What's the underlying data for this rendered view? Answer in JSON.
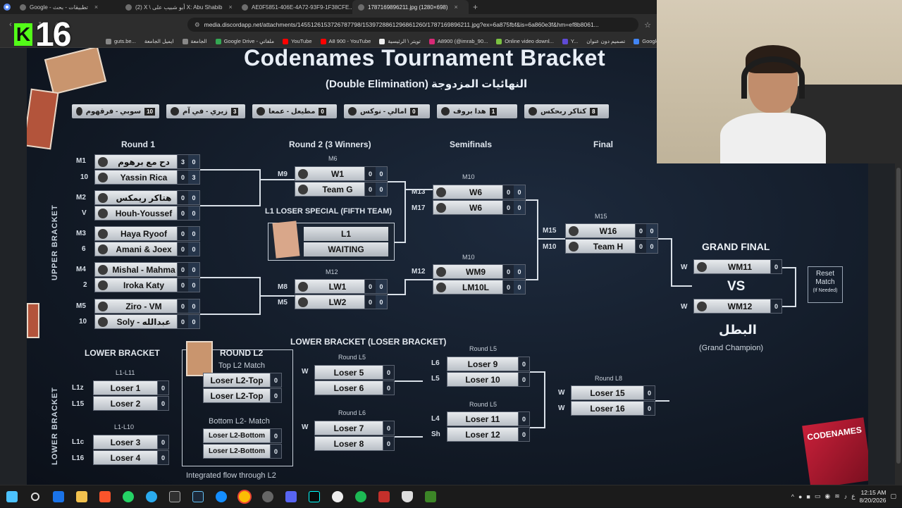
{
  "browser": {
    "tabs": [
      {
        "label": "Google - تطبيقات - بحث",
        "active": false
      },
      {
        "label": "(2) X \\ أبو شبيب على X: Abu Shabib",
        "active": false
      },
      {
        "label": "AE0F5851-406E-4A72-93F9-1F38CFE...",
        "active": false
      },
      {
        "label": "1787169896211.jpg (1280×698)",
        "active": true
      }
    ],
    "new_tab": "+",
    "url": "media.discordapp.net/attachments/1455126153726787798/1539728861296861260/1787169896211.jpg?ex=6a875fbf&is=6a860e3f&hm=ef8b8061...",
    "bookmarks": [
      "guts.be...",
      "ايميل الجامعة",
      "الجامعة",
      "Google Drive - ملفاتي",
      "YouTube",
      "A8 900 - YouTube",
      "تويتر \\ الرئيسية",
      "A8900 (@imrab_90...",
      "Online video downl...",
      "Y...",
      "تصميم دون عنوان",
      "Google"
    ]
  },
  "stream_overlay": {
    "platform_letter": "K",
    "counter": "16"
  },
  "bracket": {
    "title": "Codenames Tournament Bracket",
    "subtitle": "(Double Elimination) النهائيات المزدوجة",
    "team_strip": [
      {
        "name": "سوبي - فرقهوم",
        "n": "10"
      },
      {
        "name": "زيري - في آم",
        "n": "3"
      },
      {
        "name": "مطيعل - عمعا",
        "n": "0"
      },
      {
        "name": "امالي - نوكس",
        "n": "0"
      },
      {
        "name": "هدا بروف",
        "n": "1"
      },
      {
        "name": "كتاكر ربحكس",
        "n": "8"
      }
    ],
    "columns": {
      "round1": "Round 1",
      "round2": "Round 2 (3 Winners)",
      "semis": "Semifinals",
      "final": "Final"
    },
    "upper_label": "UPPER BRACKET",
    "lower_label": "LOWER BRACKET",
    "round1": [
      {
        "match": "M1",
        "a": {
          "seed": "",
          "name": "دح مع برهوم",
          "s1": "3",
          "s2": "0"
        },
        "b": {
          "seed": "10",
          "name": "Yassin Rica",
          "s1": "0",
          "s2": "3"
        }
      },
      {
        "match": "M2",
        "a": {
          "seed": "",
          "name": "هتاكر ريمكس",
          "s1": "0",
          "s2": "0"
        },
        "b": {
          "seed": "V",
          "name": "Houh-Youssef",
          "s1": "0",
          "s2": "0"
        }
      },
      {
        "match": "M3",
        "a": {
          "seed": "",
          "name": "Haya Ryoof",
          "s1": "0",
          "s2": "0"
        },
        "b": {
          "seed": "6",
          "name": "Amani & Joex",
          "s1": "0",
          "s2": "0"
        }
      },
      {
        "match": "M4",
        "a": {
          "seed": "",
          "name": "Mishal - Mahma",
          "s1": "0",
          "s2": "0"
        },
        "b": {
          "seed": "2",
          "name": "Iroka Katy",
          "s1": "0",
          "s2": "0"
        }
      },
      {
        "match": "M5",
        "a": {
          "seed": "",
          "name": "Ziro - VM",
          "s1": "0",
          "s2": "0"
        },
        "b": {
          "seed": "10",
          "name": "Soly - عبدالله",
          "s1": "0",
          "s2": "0"
        }
      }
    ],
    "round2_top": {
      "match": "M6",
      "a_tag": "M9",
      "a": {
        "name": "W1",
        "s1": "0",
        "s2": "0"
      },
      "b": {
        "name": "Team G",
        "s1": "0",
        "s2": "0"
      }
    },
    "special": {
      "label": "L1 LOSER SPECIAL (FIFTH TEAM)",
      "row1": "L1",
      "row2": "WAITING"
    },
    "round2_bottom": {
      "match": "M12",
      "a_tag": "M8",
      "b_tag": "M5",
      "a": {
        "name": "LW1",
        "s1": "0",
        "s2": "0"
      },
      "b": {
        "name": "LW2",
        "s1": "0",
        "s2": "0"
      }
    },
    "semi_top": {
      "match": "M10",
      "a_tag": "M13",
      "b_tag": "M17",
      "a": {
        "name": "W6",
        "s1": "0",
        "s2": "0"
      },
      "b": {
        "name": "W6",
        "s1": "0",
        "s2": "0"
      }
    },
    "semi_bottom": {
      "match": "M10",
      "a_tag": "M12",
      "a": {
        "name": "WM9",
        "s1": "0",
        "s2": "0"
      },
      "b": {
        "name": "LM10L",
        "s1": "0",
        "s2": "0"
      }
    },
    "final": {
      "match": "M15",
      "a_tag": "M15",
      "b_tag": "M10",
      "a": {
        "name": "W16",
        "s1": "0",
        "s2": "0"
      },
      "b": {
        "name": "Team H",
        "s1": "0",
        "s2": "0"
      }
    },
    "grand_final": {
      "label": "GRAND FINAL",
      "a": {
        "tag": "W",
        "name": "WM11",
        "s": "0"
      },
      "vs": "VS",
      "b": {
        "tag": "W",
        "name": "WM12",
        "s": "0"
      },
      "champion_ar": "البطل",
      "champion_en": "(Grand Champion)"
    },
    "reset": {
      "line1": "Reset",
      "line2": "Match",
      "line3": "(If Needed)"
    },
    "lower": {
      "heading": "LOWER BRACKET",
      "loser_heading": "LOWER BRACKET (LOSER BRACKET)",
      "l1_top_label": "L1-L11",
      "l1_top": [
        {
          "tag": "L1z",
          "name": "Loser 1",
          "s": "0"
        },
        {
          "tag": "L15",
          "name": "Loser 2",
          "s": "0"
        }
      ],
      "l1_bot_label": "L1-L10",
      "l1_bot": [
        {
          "tag": "L1c",
          "name": "Loser 3",
          "s": "0"
        },
        {
          "tag": "L16",
          "name": "Loser 4",
          "s": "0"
        }
      ],
      "round_l2": "ROUND L2",
      "top_l2_label": "Top L2 Match",
      "top_l2": [
        {
          "name": "Loser L2-Top",
          "s": "0"
        },
        {
          "name": "Loser L2-Top",
          "s": "0"
        }
      ],
      "bottom_l2_label": "Bottom L2- Match",
      "bottom_l2": [
        {
          "name": "Loser L2-Bottom",
          "s": "0"
        },
        {
          "name": "Loser L2-Bottom",
          "s": "0"
        }
      ],
      "integrated": "Integrated flow through L2",
      "round_l5a_label": "Round L5",
      "round_l5a_tag": "W",
      "round_l5a": [
        {
          "name": "Loser 5",
          "s": "0"
        },
        {
          "name": "Loser 6",
          "s": "0"
        }
      ],
      "round_l6_label": "Round L6",
      "round_l6_tag": "W",
      "round_l6": [
        {
          "name": "Loser 7",
          "s": "0"
        },
        {
          "name": "Loser 8",
          "s": "0"
        }
      ],
      "round_l5b_label": "Round L5",
      "round_l5b": [
        {
          "tag": "L6",
          "name": "Loser 9",
          "s": "0"
        },
        {
          "tag": "L5",
          "name": "Loser 10",
          "s": "0"
        }
      ],
      "round_l5c_label": "Round L5",
      "round_l5c": [
        {
          "tag": "L4",
          "name": "Loser 11",
          "s": "0"
        },
        {
          "tag": "Sh",
          "name": "Loser 12",
          "s": "0"
        }
      ],
      "round_l8_label": "Round L8",
      "round_l8": [
        {
          "tag": "W",
          "name": "Loser 15",
          "s": "0"
        },
        {
          "tag": "W",
          "name": "Loser 16",
          "s": "0"
        }
      ]
    },
    "box_art": "CODENAMES"
  },
  "taskbar": {
    "time": "12:15 AM",
    "date": "8/20/2026"
  }
}
